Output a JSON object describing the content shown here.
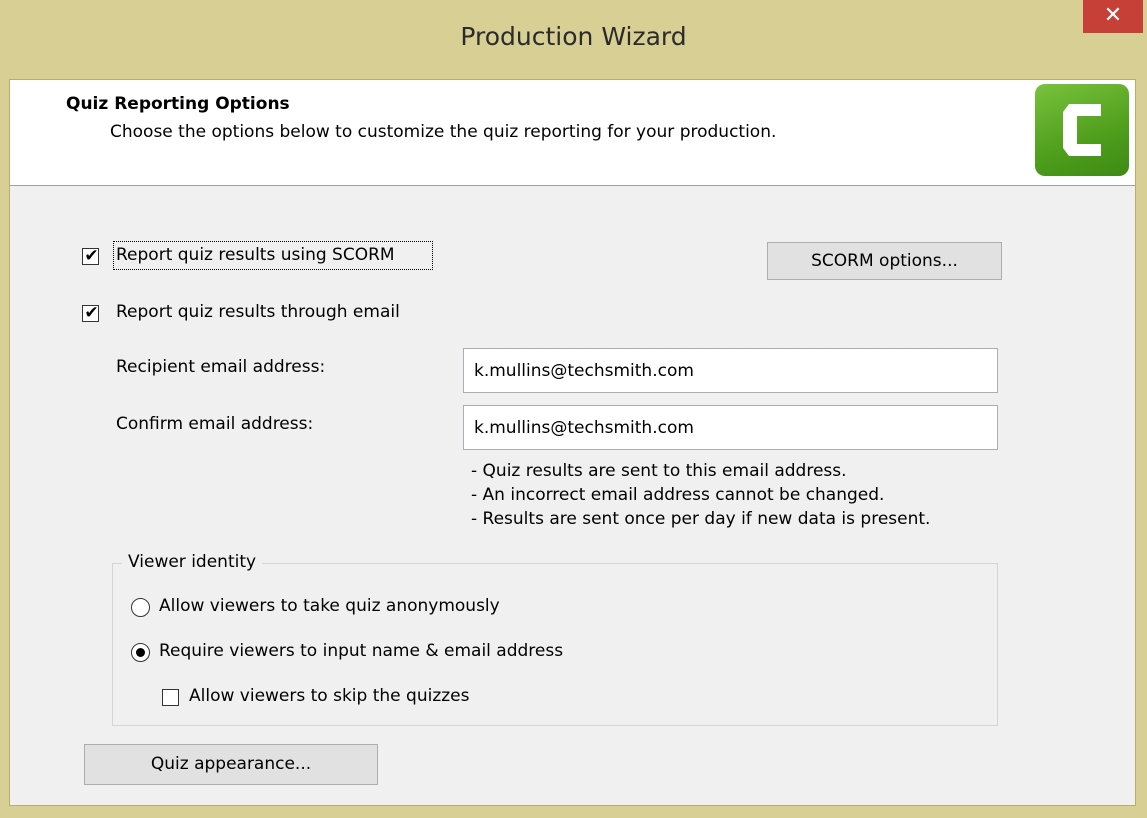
{
  "window": {
    "title": "Production Wizard",
    "close_label": "✕"
  },
  "header": {
    "title": "Quiz Reporting Options",
    "subtitle": "Choose the options below to customize the quiz reporting for your production."
  },
  "scorm": {
    "label": "Report quiz results using SCORM",
    "checked": true,
    "options_button": "SCORM options..."
  },
  "email_reporting": {
    "label": "Report quiz results through email",
    "checked": true,
    "recipient_label": "Recipient email address:",
    "recipient_value": "k.mullins@techsmith.com",
    "confirm_label": "Confirm email address:",
    "confirm_value": "k.mullins@techsmith.com",
    "notes": [
      "- Quiz results are sent to this email address.",
      "- An incorrect email address cannot be changed.",
      "- Results are sent once per day if new data is present."
    ]
  },
  "viewer_identity": {
    "legend": "Viewer identity",
    "options": [
      {
        "label": "Allow viewers to take quiz anonymously",
        "selected": false
      },
      {
        "label": "Require viewers to input name & email address",
        "selected": true
      }
    ],
    "skip_label": "Allow viewers to skip the quizzes",
    "skip_checked": false
  },
  "quiz_appearance_button": "Quiz appearance...",
  "colors": {
    "titlebar": "#d8cf94",
    "close_button": "#c74037",
    "logo_green": "#5aaa22"
  }
}
